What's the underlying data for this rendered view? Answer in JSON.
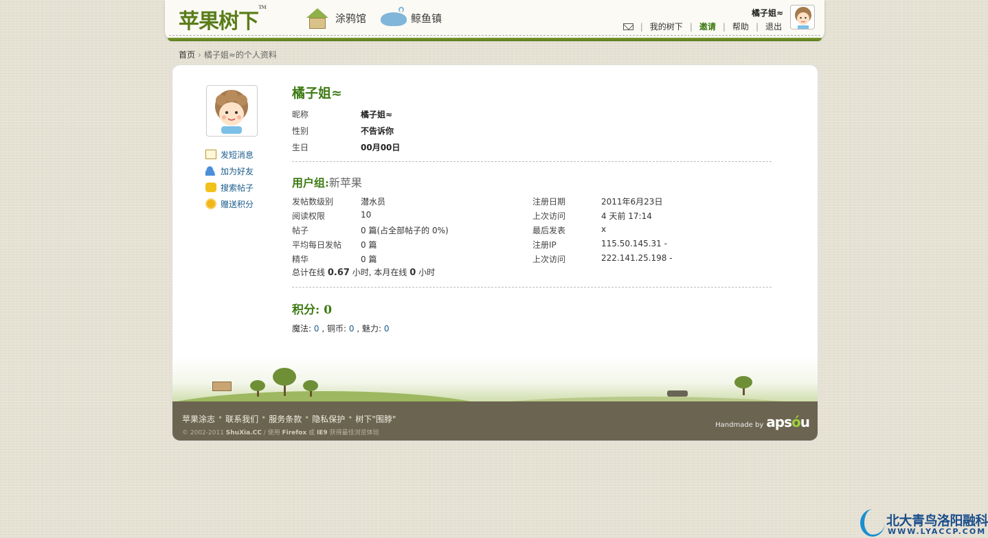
{
  "header": {
    "logo_text": "苹果树下",
    "nav": [
      {
        "label": "涂鸦馆",
        "icon": "doodle-house-icon"
      },
      {
        "label": "鲸鱼镇",
        "icon": "whale-town-icon"
      }
    ],
    "username": "橘子姐≈",
    "links": {
      "my_shuxia": "我的树下",
      "invite": "邀请",
      "help": "帮助",
      "logout": "退出"
    }
  },
  "breadcrumb": {
    "home": "首页",
    "current": "橘子姐≈的个人资料"
  },
  "profile": {
    "display_name": "橘子姐≈",
    "basic": [
      {
        "label": "昵称",
        "value": "橘子姐≈"
      },
      {
        "label": "性别",
        "value": "不告诉你"
      },
      {
        "label": "生日",
        "value": "00月00日"
      }
    ],
    "actions": [
      {
        "label": "发短消息",
        "icon": "envelope-icon"
      },
      {
        "label": "加为好友",
        "icon": "add-friend-icon"
      },
      {
        "label": "搜索帖子",
        "icon": "search-posts-icon"
      },
      {
        "label": "赠送积分",
        "icon": "gift-points-icon"
      }
    ],
    "group_label": "用户组:",
    "group_name": "新苹果",
    "stats_left": [
      {
        "label": "发帖数级别",
        "value": "潜水员"
      },
      {
        "label": "阅读权限",
        "value": "10"
      },
      {
        "label": "帖子",
        "value": "0 篇(占全部帖子的 0%)"
      },
      {
        "label": "平均每日发帖",
        "value": "0 篇"
      },
      {
        "label": "精华",
        "value": "0 篇"
      }
    ],
    "stats_right": [
      {
        "label": "注册日期",
        "value": "2011年6月23日"
      },
      {
        "label": "上次访问",
        "value": "4 天前 17:14"
      },
      {
        "label": "最后发表",
        "value": "x"
      },
      {
        "label": "注册IP",
        "value": "115.50.145.31 -"
      },
      {
        "label": "上次访问",
        "value": "222.141.25.198 -"
      }
    ],
    "online": {
      "prefix": "总计在线",
      "total": "0.67",
      "mid": "小时, 本月在线",
      "month": "0",
      "suffix": "小时"
    },
    "score_title": "积分: 0",
    "score": {
      "magic_label": "魔法:",
      "magic": "0",
      "copper_label": ", 铜币:",
      "copper": "0",
      "charm_label": ", 魅力:",
      "charm": "0"
    }
  },
  "footer": {
    "links": [
      "苹果涂志",
      "联系我们",
      "服务条款",
      "隐私保护",
      "树下\"围脖\""
    ],
    "copyright_prefix": "© 2002-2011",
    "site": "ShuXia.CC",
    "browser_note_1": "/   使用",
    "firefox": "Firefox",
    "or": "或",
    "ie": "IE9",
    "browser_note_2": "获得最佳浏览体验",
    "handmade": "Handmade by",
    "brand_a": "aps",
    "brand_o": "ó",
    "brand_u": "u"
  },
  "watermark": {
    "text": "北大青鸟洛阳融科",
    "url": "WWW.LYACCP.COM"
  },
  "colors": {
    "accent_green": "#3d7a12",
    "link_blue": "#1a5c8a",
    "footer_bg": "#6b6450"
  }
}
